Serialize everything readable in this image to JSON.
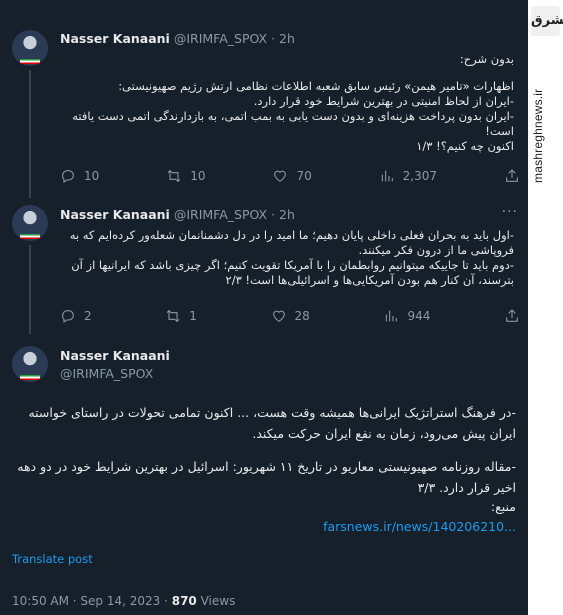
{
  "colors": {
    "background": "#15202b",
    "text": "#e7e9ea",
    "muted": "#8b98a5",
    "link": "#1d9bf0",
    "divider": "#38444d"
  },
  "watermark": {
    "logo_text": "مشرق",
    "site": "mashreghnews.ir"
  },
  "tweets": [
    {
      "author": "Nasser Kanaani",
      "handle": "@IRIMFA_SPOX",
      "time": "· 2h",
      "lines": [
        "بدون شرح:",
        "",
        "اظهارات «تامیر هیمن» رئیس سابق شعبه اطلاعات نظامی ارتش رژیم صهیونیستی:",
        "-ایران از لحاظ امنیتی در بهترین شرایط خود قرار دارد.",
        "-ایران بدون پرداخت هزینه‌ای و بدون دست یابی به بمب اتمی، به بازدارندگی اتمی دست یافته است!",
        "اکنون چه کنیم؟! ۱/۳"
      ],
      "stats": {
        "replies": "10",
        "reposts": "10",
        "likes": "70",
        "views": "2,307"
      }
    },
    {
      "author": "Nasser Kanaani",
      "handle": "@IRIMFA_SPOX",
      "time": "· 2h",
      "lines": [
        "-اول باید به بحران فعلی داخلی پایان دهیم؛ ما امید را در دل دشمنانمان شعله‌ور کرده‌ایم که به فروپاشی ما از درون فکر میکنند.",
        "-دوم باید تا جاییکه میتوانیم روابطمان را با آمریکا تقویت کنیم؛ اگر چیزی باشد که ایرانیها از آن بترسند، آن کنار هم بودن آمریکایی‌ها و اسرائیلی‌ها است! ۲/۳"
      ],
      "stats": {
        "replies": "2",
        "reposts": "1",
        "likes": "28",
        "views": "944"
      }
    }
  ],
  "main_tweet": {
    "author": "Nasser Kanaani",
    "handle": "@IRIMFA_SPOX",
    "paragraphs": [
      "-در فرهنگ استراتژیک ایرانی‌ها همیشه وقت هست، ... اکنون تمامی تحولات در راستای خواسته ایران پیش می‌رود، زمان به نفع ایران حرکت میکند.",
      "",
      "-مقاله روزنامه صهیونیستی معاریو در تاریخ ۱۱ شهریور: اسرائیل در بهترین شرایط خود در دو دهه اخیر قرار دارد. ۳/۳",
      "منبع:"
    ],
    "link": "farsnews.ir/news/140206210...",
    "translate": "Translate post",
    "timestamp": "10:50 AM · Sep 14, 2023 · ",
    "views_count": "870",
    "views_label": " Views"
  }
}
